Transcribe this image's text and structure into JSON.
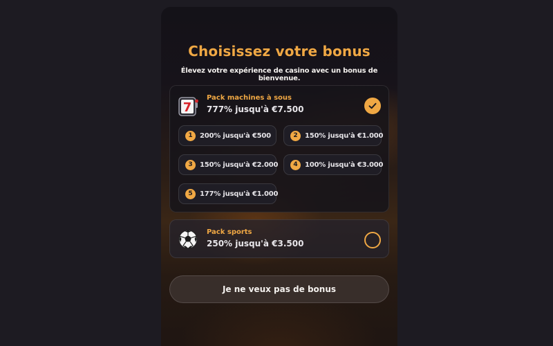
{
  "modal": {
    "title": "Choisissez votre bonus",
    "subtitle": "Élevez votre expérience de casino avec un bonus de bienvenue."
  },
  "packs": [
    {
      "name": "Pack machines à sous",
      "amount": "777% jusqu'à €7.500",
      "icon": "slot-777-icon",
      "selected": true,
      "options": [
        {
          "num": "1",
          "text": "200% jusqu'à €500"
        },
        {
          "num": "2",
          "text": "150% jusqu'à €1.000"
        },
        {
          "num": "3",
          "text": "150% jusqu'à €2.000"
        },
        {
          "num": "4",
          "text": "100% jusqu'à €3.000"
        },
        {
          "num": "5",
          "text": "177% jusqu'à €1.000"
        }
      ]
    },
    {
      "name": "Pack sports",
      "amount": "250% jusqu'à €3.500",
      "icon": "soccer-ball-icon",
      "selected": false
    }
  ],
  "no_bonus_label": "Je ne veux pas de bonus",
  "colors": {
    "accent": "#f0a844",
    "background": "#1d1b22",
    "text": "#f4f1ee"
  }
}
